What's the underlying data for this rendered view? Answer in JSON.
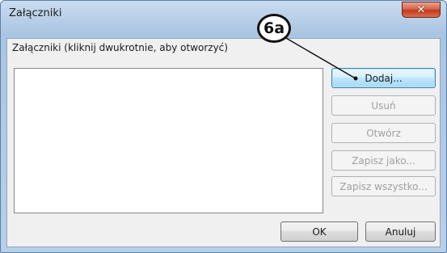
{
  "window": {
    "title": "Załączniki",
    "close_icon": "close-icon",
    "close_glyph": "✕"
  },
  "dialog": {
    "list_label": "Załączniki (kliknij dwukrotnie, aby otworzyć)"
  },
  "buttons": {
    "add": "Dodaj...",
    "remove": "Usuń",
    "open": "Otwórz",
    "save_as": "Zapisz jako...",
    "save_all": "Zapisz wszystko...",
    "ok": "OK",
    "cancel": "Anuluj"
  },
  "annotation": {
    "label": "6a"
  },
  "colors": {
    "title_bar": "#b4cce6",
    "close_button": "#c5391c",
    "default_button_border": "#3c7fb1",
    "disabled_text": "#a0a0a0"
  }
}
